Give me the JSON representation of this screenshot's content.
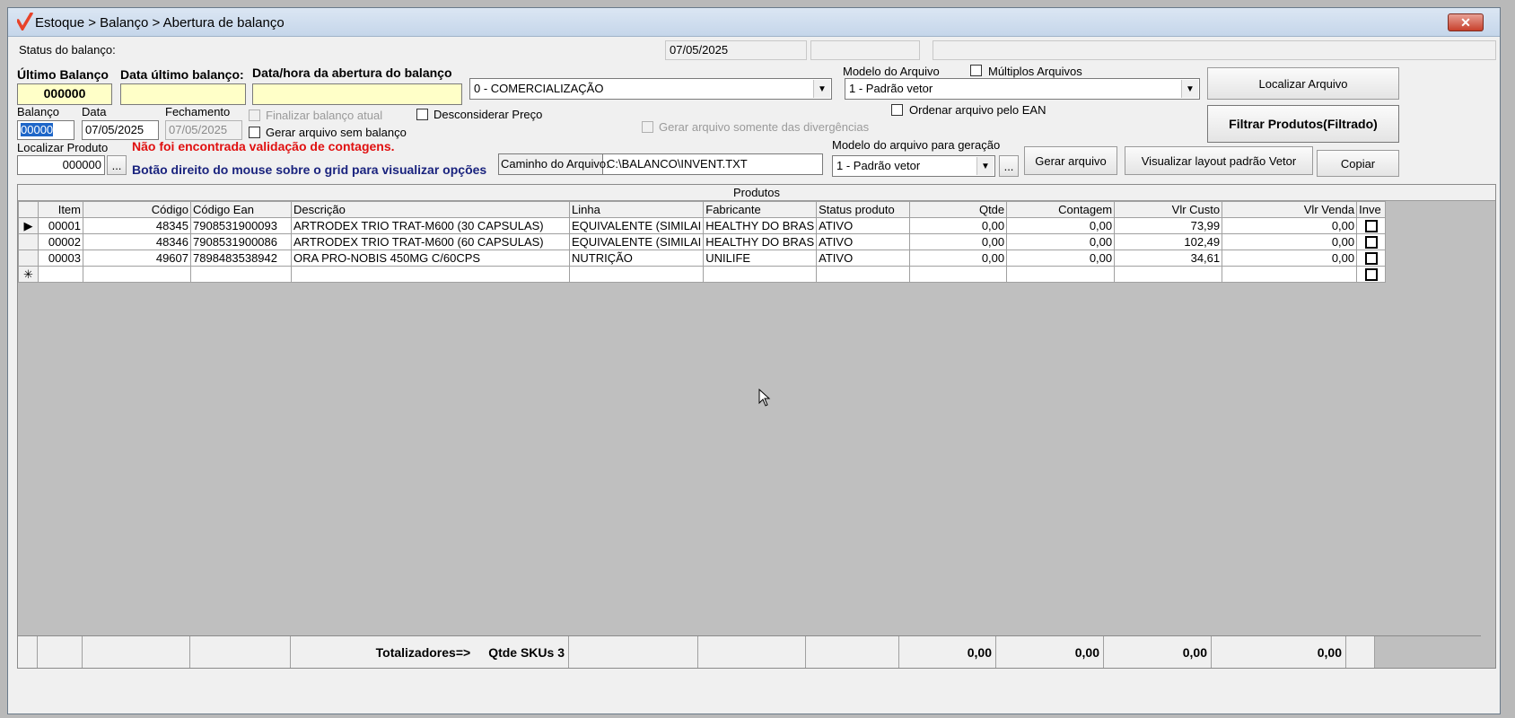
{
  "window": {
    "title": "Estoque > Balanço > Abertura de balanço",
    "close_glyph": "✕"
  },
  "status": {
    "label": "Status do balanço:",
    "date": "07/05/2025",
    "box2": "",
    "box3": ""
  },
  "header": {
    "ultimo_balanco_label": "Último Balanço",
    "ultimo_balanco_value": "000000",
    "data_ultimo_label": "Data último balanço:",
    "data_ultimo_value": "",
    "data_abertura_label": "Data/hora da abertura do balanço",
    "data_abertura_value": "",
    "tipo_combo": "0 - COMERCIALIZAÇÃO",
    "modelo_arquivo_label": "Modelo do Arquivo",
    "modelo_arquivo_value": "1 - Padrão vetor",
    "multiplos_label": "Múltiplos Arquivos",
    "localizar_arquivo": "Localizar Arquivo",
    "filtrar_produtos": "Filtrar Produtos(Filtrado)"
  },
  "row2": {
    "balanco_label": "Balanço",
    "balanco_value": "00000",
    "data_label": "Data",
    "data_value": "07/05/2025",
    "fechamento_label": "Fechamento",
    "fechamento_value": "07/05/2025",
    "finalizar_label": "Finalizar balanço atual",
    "gerar_sem_label": "Gerar arquivo sem balanço",
    "desconsiderar_label": "Desconsiderar Preço",
    "gerar_divergencias_label": "Gerar arquivo somente das divergências",
    "ordenar_ean_label": "Ordenar arquivo pelo EAN"
  },
  "row3": {
    "localizar_label": "Localizar Produto",
    "localizar_value": "000000",
    "ellipsis": "...",
    "warning": "Não foi encontrada validação de contagens.",
    "hint": "Botão direito do mouse sobre o grid para visualizar opções",
    "caminho_label": "Caminho do Arquivo:",
    "caminho_value": "C:\\BALANCO\\INVENT.TXT",
    "modelo_geracao_label": "Modelo do arquivo para geração",
    "modelo_geracao_value": "1 - Padrão vetor",
    "gerar_arquivo": "Gerar arquivo",
    "visualizar_layout": "Visualizar layout padrão Vetor",
    "copiar": "Copiar"
  },
  "grid": {
    "caption": "Produtos",
    "columns": [
      "Item",
      "Código",
      "Código Ean",
      "Descrição",
      "Linha",
      "Fabricante",
      "Status produto",
      "Qtde",
      "Contagem",
      "Vlr Custo",
      "Vlr Venda",
      "Inve"
    ],
    "rows": [
      {
        "indicator": "▶",
        "item": "00001",
        "codigo": "48345",
        "ean": "7908531900093",
        "descricao": "ARTRODEX TRIO TRAT-M600 (30 CAPSULAS)",
        "linha": "EQUIVALENTE (SIMILAI",
        "fabricante": "HEALTHY DO BRAS",
        "status": "ATIVO",
        "qtde": "0,00",
        "contagem": "0,00",
        "custo": "73,99",
        "venda": "0,00"
      },
      {
        "indicator": "",
        "item": "00002",
        "codigo": "48346",
        "ean": "7908531900086",
        "descricao": "ARTRODEX TRIO TRAT-M600 (60 CAPSULAS)",
        "linha": "EQUIVALENTE (SIMILAI",
        "fabricante": "HEALTHY DO BRAS",
        "status": "ATIVO",
        "qtde": "0,00",
        "contagem": "0,00",
        "custo": "102,49",
        "venda": "0,00"
      },
      {
        "indicator": "",
        "item": "00003",
        "codigo": "49607",
        "ean": "7898483538942",
        "descricao": "ORA PRO-NOBIS 450MG C/60CPS",
        "linha": "NUTRIÇÃO",
        "fabricante": "UNILIFE",
        "status": "ATIVO",
        "qtde": "0,00",
        "contagem": "0,00",
        "custo": "34,61",
        "venda": "0,00"
      }
    ],
    "new_row_indicator": "✳",
    "totals": {
      "label": "Totalizadores=>",
      "skus": "Qtde SKUs 3",
      "qtde": "0,00",
      "contagem": "0,00",
      "custo": "0,00",
      "venda": "0,00"
    }
  }
}
